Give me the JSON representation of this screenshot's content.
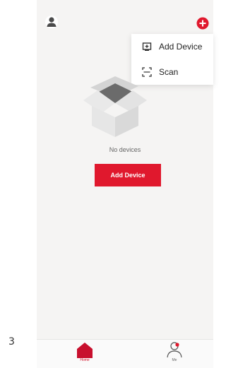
{
  "page": {
    "edge_char": "3"
  },
  "header": {
    "avatar_icon": "user-avatar-icon",
    "add_icon": "plus-circle-icon",
    "accent_color": "#e0182d"
  },
  "menu": {
    "items": [
      {
        "label": "Add Device",
        "icon": "device-add-icon"
      },
      {
        "label": "Scan",
        "icon": "scan-icon"
      }
    ]
  },
  "main": {
    "empty_text": "No devices",
    "add_button_label": "Add Device",
    "illustration_icon": "empty-box-icon"
  },
  "tabbar": {
    "tabs": [
      {
        "label": "Home",
        "icon": "home-icon",
        "active": true
      },
      {
        "label": "Me",
        "icon": "person-icon",
        "active": false
      }
    ]
  }
}
